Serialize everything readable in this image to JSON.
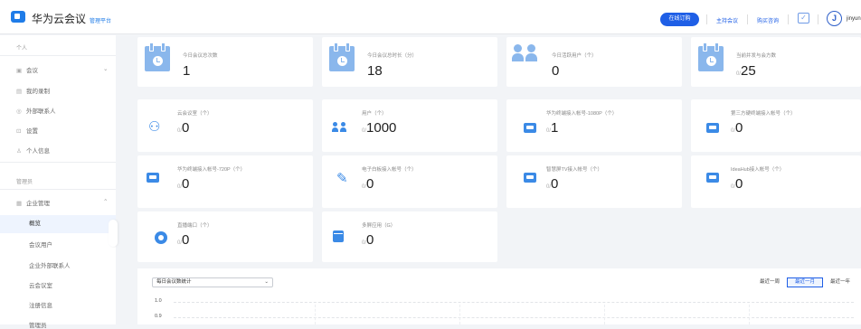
{
  "app": {
    "name": "华为云会议",
    "sub": "管理平台"
  },
  "topbar": {
    "buy": "在线订购",
    "links": [
      "主持会议",
      "购买咨询"
    ],
    "calendar": "✓",
    "avatar": "J",
    "user": "jinyun"
  },
  "sidebar": {
    "personal": "个人",
    "personal_items": [
      {
        "icon": "▣",
        "label": "会议"
      },
      {
        "icon": "▤",
        "label": "我的录制"
      },
      {
        "icon": "◎",
        "label": "外部联系人"
      },
      {
        "icon": "⊡",
        "label": "设置"
      },
      {
        "icon": "♙",
        "label": "个人信息"
      }
    ],
    "admin": "管理员",
    "enterprise": {
      "icon": "▦",
      "label": "企业管理"
    },
    "sub_items": [
      "概览",
      "会议用户",
      "企业外部联系人",
      "云会议室",
      "注册信息",
      "管理员"
    ]
  },
  "stats": {
    "today_count": {
      "label": "今日会议总次数",
      "value": "1"
    },
    "today_duration": {
      "label": "今日会议总时长（分）",
      "value": "18"
    },
    "today_active": {
      "label": "今日活跃用户（个）",
      "value": "0"
    },
    "concurrent": {
      "label": "当前并发与会方数",
      "prefix": "0/",
      "value": "25"
    },
    "cloud_room": {
      "label": "云会议室（个）",
      "prefix": "0/",
      "value": "0"
    },
    "users": {
      "label": "用户（个）",
      "prefix": "0/",
      "value": "1000"
    },
    "hw_1080": {
      "label": "华为终端接入帐号-1080P（个）",
      "prefix": "0/",
      "value": "1"
    },
    "third_party": {
      "label": "第三方硬终端接入帐号（个）",
      "prefix": "0/",
      "value": "0"
    },
    "hw_720": {
      "label": "华为终端接入帐号-720P（个）",
      "prefix": "0/",
      "value": "0"
    },
    "whiteboard": {
      "label": "电子白板接入帐号（个）",
      "prefix": "0/",
      "value": "0"
    },
    "smart_tv": {
      "label": "智慧屏TV接入帐号（个）",
      "prefix": "0/",
      "value": "0"
    },
    "ideahub": {
      "label": "IdeaHub接入帐号（个）",
      "prefix": "0/",
      "value": "0"
    },
    "live": {
      "label": "直播端口（个）",
      "prefix": "0/",
      "value": "0"
    },
    "apps": {
      "label": "多屏应用（G）",
      "prefix": "0/",
      "value": "0"
    }
  },
  "chart": {
    "select": "每日会议数统计",
    "ranges": [
      "最近一周",
      "最近一月",
      "最近一年"
    ],
    "active_range": "最近一月",
    "yticks": [
      "1.0",
      "0.9"
    ]
  },
  "chart_data": {
    "type": "line",
    "title": "每日会议数统计",
    "ylim": [
      0,
      1.0
    ],
    "yticks": [
      1.0,
      0.9
    ],
    "series": []
  }
}
